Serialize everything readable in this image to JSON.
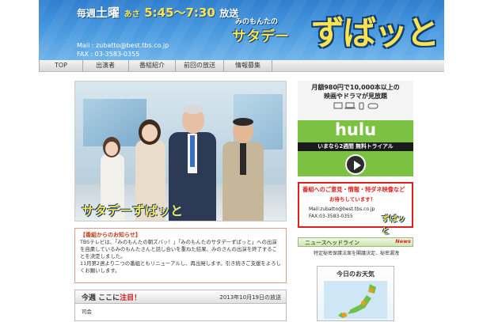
{
  "header": {
    "broadcast": {
      "every": "毎週",
      "day": "土曜",
      "morning": "あさ",
      "time": "5:45～7:30",
      "suffix": "放送"
    },
    "mail": "Mail : zubatto@best.tbs.co.jp",
    "fax": "FAX : 03-3583-0355",
    "logo_small": "みのもんたの",
    "logo_sata": "サタデー",
    "logo_main": "ずばッと"
  },
  "nav": [
    "TOP",
    "出演者",
    "番組紹介",
    "前回の放送",
    "情報募集"
  ],
  "photo": {
    "logo": "サタデーずばッと"
  },
  "notice": {
    "title": "【番組からのお知らせ】",
    "body1": "TBSテレビは、「みのもんたの朝ズバッ！」「みのもんたのサタデーずばッと」への出演を自粛しているみのもんたさんと話し合いを重ねた結果、みのさんの出演を終了することを決定しました。",
    "body2": "11月第2週より二つの番組ともリニューアルし、再出発します。引き続きご支援をよろしくお願いします。"
  },
  "week": {
    "title_pre": "今週",
    "title_mid": "ここに",
    "title_red": "注目！",
    "date": "2013年10月19日の放送",
    "host_label": "司会"
  },
  "hulu": {
    "line1": "月額980円で10,000本以上の",
    "line2": "映画やドラマが見放題",
    "logo": "hulu",
    "band": "いまなら2週間 無料トライアル"
  },
  "opinion": {
    "title": "番組へのご意見・情報・特ダネ映像など",
    "sub": "お待ちしています！",
    "mail": "Mail:zubatto@best.tbs.co.jp",
    "fax": "FAX:03-3583-0355",
    "logo": "ずばッと"
  },
  "news": {
    "title": "ニュースヘッドライン",
    "badge": "News",
    "item": "特定秘密保護法案を閣議決定、秘密漏洩"
  },
  "weather": {
    "title": "今日のお天気"
  }
}
